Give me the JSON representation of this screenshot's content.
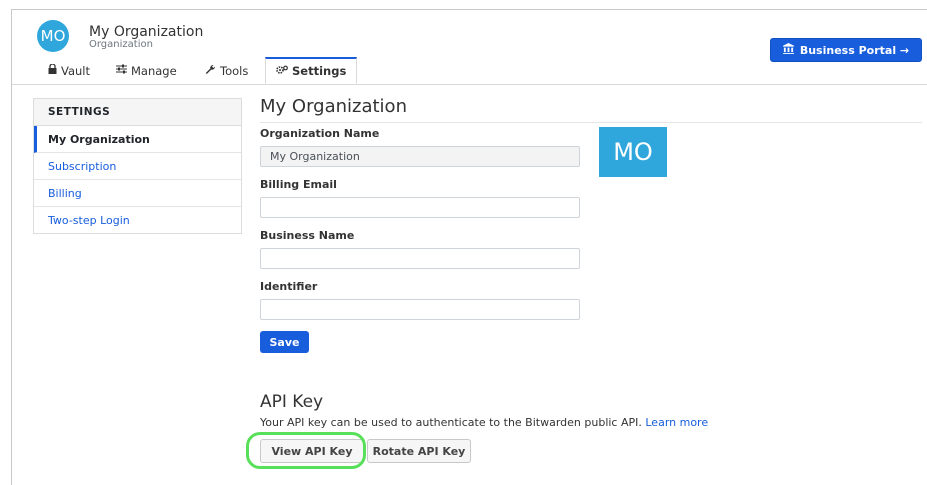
{
  "header": {
    "avatar_initials": "MO",
    "org_name": "My Organization",
    "org_type": "Organization",
    "portal_button": "Business Portal →",
    "portal_icon": "bank-icon"
  },
  "tabs": [
    {
      "label": "Vault",
      "icon": "lock-icon"
    },
    {
      "label": "Manage",
      "icon": "sliders-icon"
    },
    {
      "label": "Tools",
      "icon": "wrench-icon"
    },
    {
      "label": "Settings",
      "icon": "gears-icon",
      "active": true
    }
  ],
  "sidebar": {
    "heading": "SETTINGS",
    "items": [
      {
        "label": "My Organization",
        "active": true
      },
      {
        "label": "Subscription"
      },
      {
        "label": "Billing"
      },
      {
        "label": "Two-step Login"
      }
    ]
  },
  "main": {
    "title": "My Organization",
    "logo_initials": "MO",
    "fields": [
      {
        "label": "Organization Name",
        "value": "My Organization"
      },
      {
        "label": "Billing Email",
        "value": ""
      },
      {
        "label": "Business Name",
        "value": ""
      },
      {
        "label": "Identifier",
        "value": ""
      }
    ],
    "save_label": "Save",
    "api": {
      "title": "API Key",
      "description": "Your API key can be used to authenticate to the Bitwarden public API.",
      "learn_more": "Learn more",
      "view_button": "View API Key",
      "rotate_button": "Rotate API Key"
    }
  },
  "colors": {
    "primary": "#175ddc",
    "avatar": "#2fa7dc",
    "highlight": "#59e05a"
  }
}
